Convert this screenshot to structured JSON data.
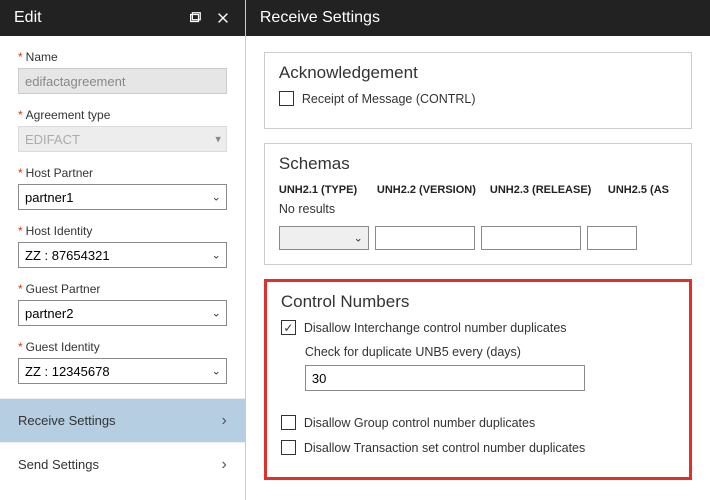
{
  "editPanel": {
    "title": "Edit",
    "fields": {
      "nameLabel": "Name",
      "nameValue": "edifactagreement",
      "agreementTypeLabel": "Agreement type",
      "agreementTypeValue": "EDIFACT",
      "hostPartnerLabel": "Host Partner",
      "hostPartnerValue": "partner1",
      "hostIdentityLabel": "Host Identity",
      "hostIdentityValue": "ZZ : 87654321",
      "guestPartnerLabel": "Guest Partner",
      "guestPartnerValue": "partner2",
      "guestIdentityLabel": "Guest Identity",
      "guestIdentityValue": "ZZ : 12345678"
    },
    "nav": {
      "receive": "Receive Settings",
      "send": "Send Settings"
    }
  },
  "receivePanel": {
    "title": "Receive Settings",
    "ack": {
      "title": "Acknowledgement",
      "receiptLabel": "Receipt of Message (CONTRL)"
    },
    "schemas": {
      "title": "Schemas",
      "col1": "UNH2.1 (TYPE)",
      "col2": "UNH2.2 (VERSION)",
      "col3": "UNH2.3 (RELEASE)",
      "col4": "UNH2.5 (AS",
      "noResults": "No results"
    },
    "control": {
      "title": "Control Numbers",
      "disallowInterchange": "Disallow Interchange control number duplicates",
      "checkDupLabel": "Check for duplicate UNB5 every (days)",
      "checkDupValue": "30",
      "disallowGroup": "Disallow Group control number duplicates",
      "disallowTxn": "Disallow Transaction set control number duplicates"
    }
  }
}
